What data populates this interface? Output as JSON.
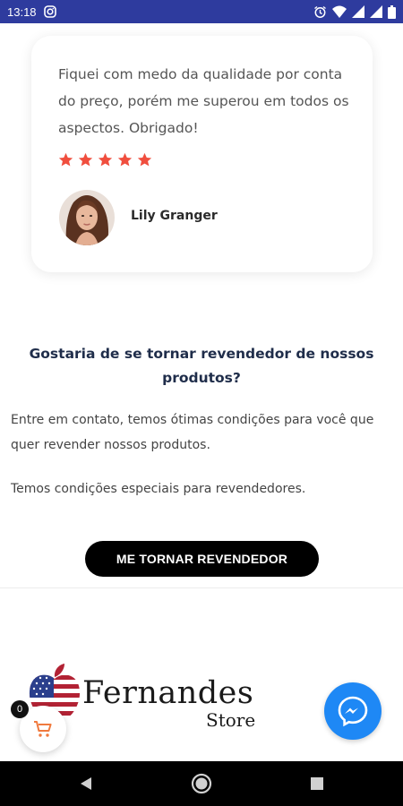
{
  "status_bar": {
    "time": "13:18",
    "icons": [
      "instagram-icon",
      "alarm-icon",
      "wifi-icon",
      "signal-icon",
      "signal-icon",
      "battery-icon"
    ]
  },
  "testimonial": {
    "quote": "Fiquei com medo da qualidade por conta do preço, porém me superou em todos os aspectos. Obrigado!",
    "rating": 5,
    "star_color": "#f04e3e",
    "author": "Lily Granger"
  },
  "reseller": {
    "title": "Gostaria de se tornar revendedor de nossos produtos?",
    "text1": "Entre em contato, temos ótimas condições para você que quer revender nossos produtos.",
    "text2": "Temos condições especiais para revendedores.",
    "cta_label": "ME TORNAR REVENDEDOR"
  },
  "footer": {
    "logo_name": "Fernandes",
    "logo_sub": "Store",
    "cart_count": "0",
    "cart_color": "#f07a3e",
    "messenger_color": "#1e88f5"
  },
  "nav": {
    "icons": [
      "back-icon",
      "home-icon",
      "recents-icon"
    ]
  }
}
